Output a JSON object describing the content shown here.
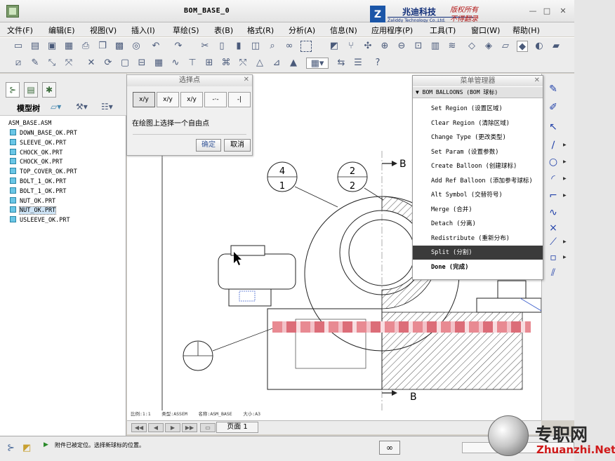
{
  "window": {
    "title": "BOM_BASE_0",
    "brand_name": "兆迪科技",
    "brand_english": "Zaliddy Technology Co.,Ltd.",
    "copyright_line1": "版权所有",
    "copyright_line2": "不得翻录",
    "controls": [
      "—",
      "□",
      "✕"
    ]
  },
  "menubar": [
    "文件(F)",
    "编辑(E)",
    "视图(V)",
    "插入(I)",
    "草绘(S)",
    "表(B)",
    "格式(R)",
    "分析(A)",
    "信息(N)",
    "应用程序(P)",
    "工具(T)",
    "窗口(W)",
    "帮助(H)"
  ],
  "toolbar_icons": [
    "new-icon",
    "open-icon",
    "save-icon",
    "print-icon",
    "copy-icon",
    "undo-icon",
    "redo-icon",
    "cut-icon",
    "paste-icon",
    "search-icon",
    "select-icon",
    "zoom-in-icon",
    "zoom-out-icon",
    "refit-icon",
    "layers-icon",
    "view-icon"
  ],
  "nav": {
    "tree_title": "模型树",
    "root": "ASM_BASE.ASM",
    "items": [
      "DOWN_BASE_OK.PRT",
      "SLEEVE_OK.PRT",
      "CHOCK_OK.PRT",
      "CHOCK_OK.PRT",
      "TOP_COVER_OK.PRT",
      "BOLT_1_OK.PRT",
      "BOLT_1_OK.PRT",
      "NUT_OK.PRT",
      "NUT_OK.PRT",
      "USLEEVE_OK.PRT"
    ],
    "selected_index": 8
  },
  "select_dialog": {
    "title": "选择点",
    "hint": "在绘图上选择一个自由点",
    "ok": "确定",
    "cancel": "取消",
    "tools": [
      "x/y",
      "x/y",
      "x/y",
      "-·-",
      "-|"
    ]
  },
  "menu_manager": {
    "title": "菜单管理器",
    "header": "BOM BALLOONS (BOM 球标)",
    "items": [
      "Set Region (设置区域)",
      "Clear Region (清除区域)",
      "Change Type (更改类型)",
      "Set Param (设置参数)",
      "Create Balloon (创建球标)",
      "Add Ref Balloon (添加参考球标)",
      "Alt Symbol (交替符号)",
      "Merge (合并)",
      "Detach (分离)",
      "Redistribute (重新分布)",
      "Split (分割)",
      "Done (完成)"
    ],
    "active_index": 10
  },
  "drawing": {
    "balloon_1_top": "4",
    "balloon_1_bottom": "1",
    "balloon_2_top": "2",
    "balloon_2_bottom": "2",
    "section_label_top": "B",
    "section_label_bottom": "B",
    "status_strip": "比例:1:1    类型:ASSEM    名称:ASM_BASE    大小:A3"
  },
  "page_bar": {
    "page_label": "页面 1"
  },
  "status": {
    "message": "附件已被定位。选择新球标的位置。"
  },
  "watermark": {
    "text": "专职网",
    "url": "Zhuanzhi.Net"
  }
}
